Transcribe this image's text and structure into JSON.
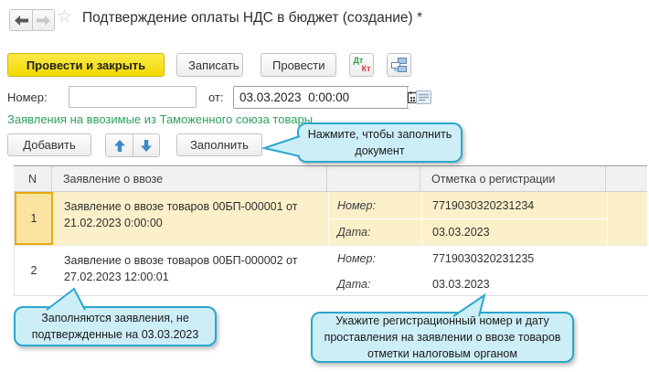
{
  "window": {
    "title": "Подтверждение оплаты НДС в бюджет (создание) *"
  },
  "toolbar": {
    "post_close": "Провести и закрыть",
    "save": "Записать",
    "post": "Провести",
    "dtkt_dt": "Дт",
    "dtkt_kt": "Кт"
  },
  "fields": {
    "number_label": "Номер:",
    "number_value": "",
    "date_label": "от:",
    "date_value": "03.03.2023  0:00:00"
  },
  "section": {
    "title": "Заявления на ввозимые из Таможенного союза товары"
  },
  "commands": {
    "add": "Добавить",
    "fill": "Заполнить"
  },
  "callouts": {
    "fill_hint": "Нажмите, чтобы заполнить документ",
    "fill_note": "Заполняются заявления, не подтвержденные на 03.03.2023",
    "reg_note": "Укажите регистрационный номер и дату проставления на заявлении о ввозе товаров отметки налоговым органом"
  },
  "table": {
    "headers": {
      "num": "N",
      "application": "Заявление о ввозе",
      "mark": "Отметка о регистрации"
    },
    "row_labels": {
      "number": "Номер:",
      "date": "Дата:"
    },
    "rows": [
      {
        "num": "1",
        "application": "Заявление о ввозе товаров 00БП-000001 от 21.02.2023 0:00:00",
        "reg_number": "7719030320231234",
        "reg_date": "03.03.2023",
        "selected": true
      },
      {
        "num": "2",
        "application": "Заявление о ввозе товаров 00БП-000002 от 27.02.2023 12:00:01",
        "reg_number": "7719030320231235",
        "reg_date": "03.03.2023",
        "selected": false
      }
    ]
  },
  "colors": {
    "accent_yellow": "#f3da00",
    "selected_row": "#fcf0cb",
    "focused_cell": "#fbe3a2",
    "focused_cell_border": "#e5ac0e",
    "callout_fill": "#cdeef7",
    "callout_border": "#2aa7cd",
    "section_green": "#2da05f",
    "arrow_blue": "#3b8bc6"
  }
}
